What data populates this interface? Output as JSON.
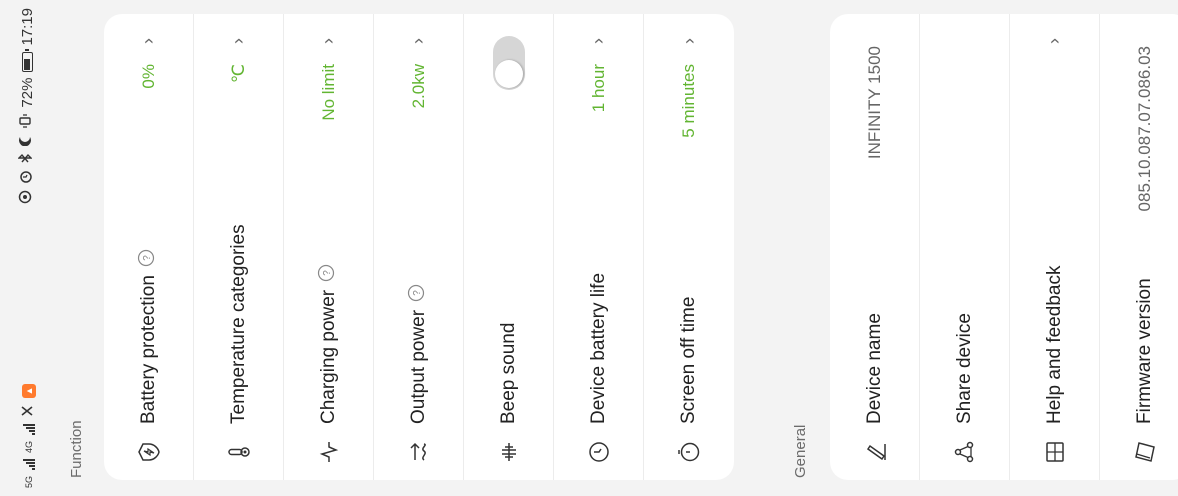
{
  "status_bar": {
    "network_left": "5G",
    "network_right": "4G",
    "battery_percent": "72%",
    "battery_level": 0.72,
    "time": "17:19"
  },
  "function": {
    "label": "Function",
    "items": [
      {
        "label": "Battery protection",
        "value": "0%",
        "has_help": true,
        "icon": "lightning-shield-icon"
      },
      {
        "label": "Temperature categories",
        "value": "℃",
        "has_help": false,
        "icon": "thermometer-icon"
      },
      {
        "label": "Charging power",
        "value": "No limit",
        "has_help": true,
        "icon": "pulse-icon"
      },
      {
        "label": "Output power",
        "value": "2.0kw",
        "has_help": true,
        "icon": "output-arrows-icon"
      },
      {
        "label": "Beep sound",
        "toggle_on": false,
        "icon": "sound-wave-icon"
      },
      {
        "label": "Device battery life",
        "value": "1 hour",
        "has_help": false,
        "icon": "clock-icon"
      },
      {
        "label": "Screen off time",
        "value": "5 minutes",
        "has_help": false,
        "icon": "timer-icon"
      }
    ]
  },
  "general": {
    "label": "General",
    "items": [
      {
        "label": "Device name",
        "value": "INFINITY 1500",
        "icon": "pencil-icon"
      },
      {
        "label": "Share device",
        "value": "",
        "icon": "share-icon"
      },
      {
        "label": "Help and feedback",
        "value": "",
        "icon": "book-icon"
      },
      {
        "label": "Firmware version",
        "value": "085.10.087.07.086.03",
        "icon": "firmware-icon"
      }
    ]
  },
  "colors": {
    "accent": "#62b532",
    "background": "#f3f3f3",
    "card": "#ffffff"
  }
}
